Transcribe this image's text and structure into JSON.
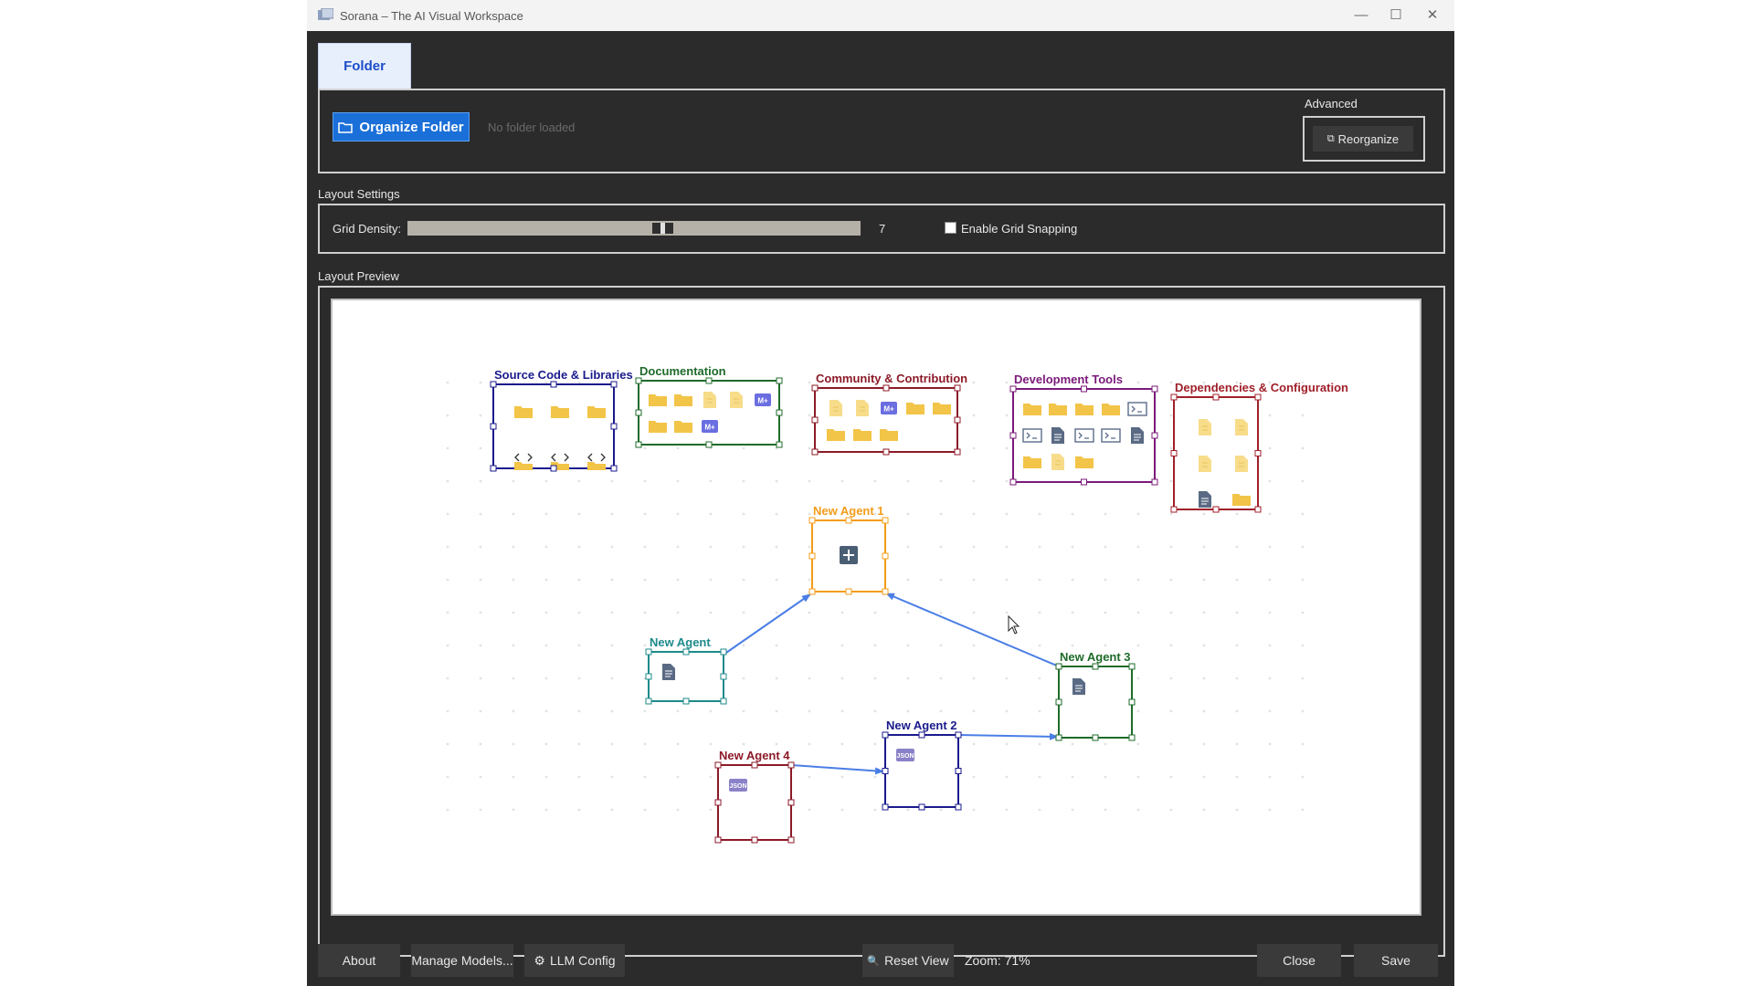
{
  "window": {
    "title": "Sorana – The AI Visual Workspace"
  },
  "tabs": [
    {
      "label": "Folder",
      "active": true
    }
  ],
  "toolbar": {
    "organize_label": "Organize Folder",
    "status": "No folder loaded"
  },
  "advanced": {
    "label": "Advanced",
    "reorganize_label": "Reorganize"
  },
  "layout_settings": {
    "label": "Layout Settings",
    "grid_density_label": "Grid Density:",
    "grid_density_value": "7",
    "grid_density_fraction": 0.56,
    "snapping_label": "Enable Grid Snapping",
    "snapping_checked": false
  },
  "preview": {
    "label": "Layout Preview"
  },
  "canvas": {
    "groups": [
      {
        "id": "src",
        "title": "Source Code & Libraries",
        "color": "#1a1a8c",
        "icons": [
          "folder",
          "folder",
          "folder",
          "code-folder",
          "code-folder",
          "code-folder"
        ]
      },
      {
        "id": "doc",
        "title": "Documentation",
        "color": "#1e6b2a",
        "icons": [
          "folder",
          "folder",
          "file",
          "file",
          "markdown",
          "folder",
          "folder",
          "markdown"
        ]
      },
      {
        "id": "com",
        "title": "Community & Contribution",
        "color": "#8c1a28",
        "icons": [
          "file",
          "file",
          "markdown",
          "folder",
          "folder",
          "folder",
          "folder",
          "folder"
        ]
      },
      {
        "id": "dev",
        "title": "Development Tools",
        "color": "#7a1a7a",
        "icons": [
          "folder",
          "folder",
          "folder",
          "folder",
          "terminal",
          "terminal",
          "document",
          "terminal",
          "terminal",
          "document",
          "folder",
          "file",
          "folder"
        ]
      },
      {
        "id": "dep",
        "title": "Dependencies & Configuration",
        "color": "#a0202a",
        "icons": [
          "file",
          "file",
          "file",
          "file",
          "document",
          "folder"
        ]
      }
    ],
    "agents": [
      {
        "id": "a1",
        "title": "New Agent 1",
        "color": "#f39c1a",
        "icon": "add"
      },
      {
        "id": "a0",
        "title": "New Agent",
        "color": "#1e8a8a",
        "icon": "document"
      },
      {
        "id": "a3",
        "title": "New Agent 3",
        "color": "#1e6b2a",
        "icon": "document"
      },
      {
        "id": "a2",
        "title": "New Agent 2",
        "color": "#1a1a8c",
        "icon": "json"
      },
      {
        "id": "a4",
        "title": "New Agent 4",
        "color": "#8c1a28",
        "icon": "json"
      }
    ],
    "connections": [
      {
        "from": "a0",
        "to": "a1"
      },
      {
        "from": "a3",
        "to": "a1"
      },
      {
        "from": "a2",
        "to": "a3"
      },
      {
        "from": "a4",
        "to": "a2"
      }
    ],
    "json_badge": "JSON",
    "md_badge": "M+"
  },
  "footer": {
    "about": "About",
    "manage_models": "Manage Models...",
    "llm_config": "LLM Config",
    "reset_view": "Reset View",
    "zoom": "Zoom: 71%",
    "close": "Close",
    "save": "Save"
  },
  "colors": {
    "accent": "#1a6fd8",
    "connection": "#4a7ee6",
    "folder": "#f2c447",
    "file": "#f7dc8a",
    "badge": "#6a6ee0"
  }
}
